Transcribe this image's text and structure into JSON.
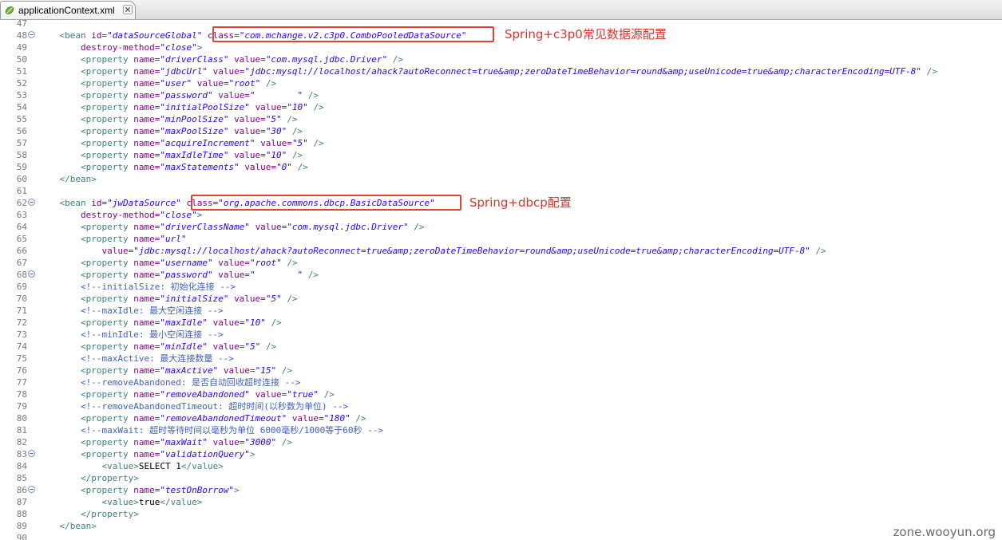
{
  "tab": {
    "label": "applicationContext.xml",
    "icon": "xml-leaf-icon",
    "close_icon": "close-icon"
  },
  "annotations": {
    "c3p0": "Spring+c3p0常见数据源配置",
    "dbcp": "Spring+dbcp配置"
  },
  "watermark": "zone.wooyun.org",
  "colors": {
    "tag": "#3f7f7f",
    "attr": "#7f007f",
    "value": "#2a00ff",
    "comment": "#3f5fbf",
    "highlight": "#e0462f"
  },
  "lines": [
    {
      "n": "47",
      "fold": false,
      "tokens": []
    },
    {
      "n": "48",
      "fold": true,
      "tokens": [
        [
          "p",
          "    "
        ],
        [
          "tag",
          "<bean "
        ],
        [
          "attr",
          "id="
        ],
        [
          "val",
          "\"dataSourceGlobal\""
        ],
        [
          "p",
          " "
        ],
        [
          "attr",
          "class="
        ],
        [
          "val",
          "\"com.mchange.v2.c3p0.ComboPooledDataSource\""
        ]
      ]
    },
    {
      "n": "49",
      "fold": false,
      "tokens": [
        [
          "p",
          "        "
        ],
        [
          "attr",
          "destroy-method="
        ],
        [
          "val",
          "\"close\""
        ],
        [
          "tag",
          ">"
        ]
      ]
    },
    {
      "n": "50",
      "fold": false,
      "tokens": [
        [
          "p",
          "        "
        ],
        [
          "tag",
          "<property "
        ],
        [
          "attr",
          "name="
        ],
        [
          "val",
          "\"driverClass\""
        ],
        [
          "p",
          " "
        ],
        [
          "attr",
          "value="
        ],
        [
          "val",
          "\"com.mysql.jdbc.Driver\""
        ],
        [
          "p",
          " "
        ],
        [
          "tag",
          "/>"
        ]
      ]
    },
    {
      "n": "51",
      "fold": false,
      "tokens": [
        [
          "p",
          "        "
        ],
        [
          "tag",
          "<property "
        ],
        [
          "attr",
          "name="
        ],
        [
          "val",
          "\"jdbcUrl\""
        ],
        [
          "p",
          " "
        ],
        [
          "attr",
          "value="
        ],
        [
          "val",
          "\"jdbc:mysql://localhost/ahack?autoReconnect=true&amp;zeroDateTimeBehavior=round&amp;useUnicode=true&amp;characterEncoding=UTF-8\""
        ],
        [
          "p",
          " "
        ],
        [
          "tag",
          "/>"
        ]
      ]
    },
    {
      "n": "52",
      "fold": false,
      "tokens": [
        [
          "p",
          "        "
        ],
        [
          "tag",
          "<property "
        ],
        [
          "attr",
          "name="
        ],
        [
          "val",
          "\"user\""
        ],
        [
          "p",
          " "
        ],
        [
          "attr",
          "value="
        ],
        [
          "val",
          "\"root\""
        ],
        [
          "p",
          " "
        ],
        [
          "tag",
          "/>"
        ]
      ]
    },
    {
      "n": "53",
      "fold": false,
      "tokens": [
        [
          "p",
          "        "
        ],
        [
          "tag",
          "<property "
        ],
        [
          "attr",
          "name="
        ],
        [
          "val",
          "\"password\""
        ],
        [
          "p",
          " "
        ],
        [
          "attr",
          "value="
        ],
        [
          "val",
          "\"        \""
        ],
        [
          "p",
          " "
        ],
        [
          "tag",
          "/>"
        ]
      ],
      "redact": true
    },
    {
      "n": "54",
      "fold": false,
      "tokens": [
        [
          "p",
          "        "
        ],
        [
          "tag",
          "<property "
        ],
        [
          "attr",
          "name="
        ],
        [
          "val",
          "\"initialPoolSize\""
        ],
        [
          "p",
          " "
        ],
        [
          "attr",
          "value="
        ],
        [
          "val",
          "\"10\""
        ],
        [
          "p",
          " "
        ],
        [
          "tag",
          "/>"
        ]
      ]
    },
    {
      "n": "55",
      "fold": false,
      "tokens": [
        [
          "p",
          "        "
        ],
        [
          "tag",
          "<property "
        ],
        [
          "attr",
          "name="
        ],
        [
          "val",
          "\"minPoolSize\""
        ],
        [
          "p",
          " "
        ],
        [
          "attr",
          "value="
        ],
        [
          "val",
          "\"5\""
        ],
        [
          "p",
          " "
        ],
        [
          "tag",
          "/>"
        ]
      ]
    },
    {
      "n": "56",
      "fold": false,
      "tokens": [
        [
          "p",
          "        "
        ],
        [
          "tag",
          "<property "
        ],
        [
          "attr",
          "name="
        ],
        [
          "val",
          "\"maxPoolSize\""
        ],
        [
          "p",
          " "
        ],
        [
          "attr",
          "value="
        ],
        [
          "val",
          "\"30\""
        ],
        [
          "p",
          " "
        ],
        [
          "tag",
          "/>"
        ]
      ]
    },
    {
      "n": "57",
      "fold": false,
      "tokens": [
        [
          "p",
          "        "
        ],
        [
          "tag",
          "<property "
        ],
        [
          "attr",
          "name="
        ],
        [
          "val",
          "\"acquireIncrement\""
        ],
        [
          "p",
          " "
        ],
        [
          "attr",
          "value="
        ],
        [
          "val",
          "\"5\""
        ],
        [
          "p",
          " "
        ],
        [
          "tag",
          "/>"
        ]
      ]
    },
    {
      "n": "58",
      "fold": false,
      "tokens": [
        [
          "p",
          "        "
        ],
        [
          "tag",
          "<property "
        ],
        [
          "attr",
          "name="
        ],
        [
          "val",
          "\"maxIdleTime\""
        ],
        [
          "p",
          " "
        ],
        [
          "attr",
          "value="
        ],
        [
          "val",
          "\"10\""
        ],
        [
          "p",
          " "
        ],
        [
          "tag",
          "/>"
        ]
      ]
    },
    {
      "n": "59",
      "fold": false,
      "tokens": [
        [
          "p",
          "        "
        ],
        [
          "tag",
          "<property "
        ],
        [
          "attr",
          "name="
        ],
        [
          "val",
          "\"maxStatements\""
        ],
        [
          "p",
          " "
        ],
        [
          "attr",
          "value="
        ],
        [
          "val",
          "\"0\""
        ],
        [
          "p",
          " "
        ],
        [
          "tag",
          "/>"
        ]
      ]
    },
    {
      "n": "60",
      "fold": false,
      "tokens": [
        [
          "p",
          "    "
        ],
        [
          "tag",
          "</bean>"
        ]
      ]
    },
    {
      "n": "61",
      "fold": false,
      "tokens": []
    },
    {
      "n": "62",
      "fold": true,
      "tokens": [
        [
          "p",
          "    "
        ],
        [
          "tag",
          "<bean "
        ],
        [
          "attr",
          "id="
        ],
        [
          "val",
          "\"jwDataSource\""
        ],
        [
          "p",
          " "
        ],
        [
          "attr",
          "class="
        ],
        [
          "val",
          "\"org.apache.commons.dbcp.BasicDataSource\""
        ]
      ]
    },
    {
      "n": "63",
      "fold": false,
      "tokens": [
        [
          "p",
          "        "
        ],
        [
          "attr",
          "destroy-method="
        ],
        [
          "val",
          "\"close\""
        ],
        [
          "tag",
          ">"
        ]
      ]
    },
    {
      "n": "64",
      "fold": false,
      "tokens": [
        [
          "p",
          "        "
        ],
        [
          "tag",
          "<property "
        ],
        [
          "attr",
          "name="
        ],
        [
          "val",
          "\"driverClassName\""
        ],
        [
          "p",
          " "
        ],
        [
          "attr",
          "value="
        ],
        [
          "val",
          "\"com.mysql.jdbc.Driver\""
        ],
        [
          "p",
          " "
        ],
        [
          "tag",
          "/>"
        ]
      ]
    },
    {
      "n": "65",
      "fold": false,
      "tokens": [
        [
          "p",
          "        "
        ],
        [
          "tag",
          "<property "
        ],
        [
          "attr",
          "name="
        ],
        [
          "val",
          "\"url\""
        ]
      ]
    },
    {
      "n": "66",
      "fold": false,
      "tokens": [
        [
          "p",
          "            "
        ],
        [
          "attr",
          "value="
        ],
        [
          "val",
          "\"jdbc:mysql://localhost/ahack?autoReconnect=true&amp;zeroDateTimeBehavior=round&amp;useUnicode=true&amp;characterEncoding=UTF-8\""
        ],
        [
          "p",
          " "
        ],
        [
          "tag",
          "/>"
        ]
      ]
    },
    {
      "n": "67",
      "fold": false,
      "tokens": [
        [
          "p",
          "        "
        ],
        [
          "tag",
          "<property "
        ],
        [
          "attr",
          "name="
        ],
        [
          "val",
          "\"username\""
        ],
        [
          "p",
          " "
        ],
        [
          "attr",
          "value="
        ],
        [
          "val",
          "\"root\""
        ],
        [
          "p",
          " "
        ],
        [
          "tag",
          "/>"
        ]
      ]
    },
    {
      "n": "68",
      "fold": true,
      "tokens": [
        [
          "p",
          "        "
        ],
        [
          "tag",
          "<property "
        ],
        [
          "attr",
          "name="
        ],
        [
          "val",
          "\"password\""
        ],
        [
          "p",
          " "
        ],
        [
          "attr",
          "value="
        ],
        [
          "val",
          "\"        \""
        ],
        [
          "p",
          " "
        ],
        [
          "tag",
          "/>"
        ]
      ],
      "redact": true
    },
    {
      "n": "69",
      "fold": false,
      "tokens": [
        [
          "p",
          "        "
        ],
        [
          "com",
          "<!--initialSize: 初始化连接 -->"
        ]
      ]
    },
    {
      "n": "70",
      "fold": false,
      "tokens": [
        [
          "p",
          "        "
        ],
        [
          "tag",
          "<property "
        ],
        [
          "attr",
          "name="
        ],
        [
          "val",
          "\"initialSize\""
        ],
        [
          "p",
          " "
        ],
        [
          "attr",
          "value="
        ],
        [
          "val",
          "\"5\""
        ],
        [
          "p",
          " "
        ],
        [
          "tag",
          "/>"
        ]
      ]
    },
    {
      "n": "71",
      "fold": false,
      "tokens": [
        [
          "p",
          "        "
        ],
        [
          "com",
          "<!--maxIdle: 最大空闲连接 -->"
        ]
      ]
    },
    {
      "n": "72",
      "fold": false,
      "tokens": [
        [
          "p",
          "        "
        ],
        [
          "tag",
          "<property "
        ],
        [
          "attr",
          "name="
        ],
        [
          "val",
          "\"maxIdle\""
        ],
        [
          "p",
          " "
        ],
        [
          "attr",
          "value="
        ],
        [
          "val",
          "\"10\""
        ],
        [
          "p",
          " "
        ],
        [
          "tag",
          "/>"
        ]
      ]
    },
    {
      "n": "73",
      "fold": false,
      "tokens": [
        [
          "p",
          "        "
        ],
        [
          "com",
          "<!--minIdle: 最小空闲连接 -->"
        ]
      ]
    },
    {
      "n": "74",
      "fold": false,
      "tokens": [
        [
          "p",
          "        "
        ],
        [
          "tag",
          "<property "
        ],
        [
          "attr",
          "name="
        ],
        [
          "val",
          "\"minIdle\""
        ],
        [
          "p",
          " "
        ],
        [
          "attr",
          "value="
        ],
        [
          "val",
          "\"5\""
        ],
        [
          "p",
          " "
        ],
        [
          "tag",
          "/>"
        ]
      ]
    },
    {
      "n": "75",
      "fold": false,
      "tokens": [
        [
          "p",
          "        "
        ],
        [
          "com",
          "<!--maxActive: 最大连接数量 -->"
        ]
      ]
    },
    {
      "n": "76",
      "fold": false,
      "tokens": [
        [
          "p",
          "        "
        ],
        [
          "tag",
          "<property "
        ],
        [
          "attr",
          "name="
        ],
        [
          "val",
          "\"maxActive\""
        ],
        [
          "p",
          " "
        ],
        [
          "attr",
          "value="
        ],
        [
          "val",
          "\"15\""
        ],
        [
          "p",
          " "
        ],
        [
          "tag",
          "/>"
        ]
      ]
    },
    {
      "n": "77",
      "fold": false,
      "tokens": [
        [
          "p",
          "        "
        ],
        [
          "com",
          "<!--removeAbandoned: 是否自动回收超时连接 -->"
        ]
      ]
    },
    {
      "n": "78",
      "fold": false,
      "tokens": [
        [
          "p",
          "        "
        ],
        [
          "tag",
          "<property "
        ],
        [
          "attr",
          "name="
        ],
        [
          "val",
          "\"removeAbandoned\""
        ],
        [
          "p",
          " "
        ],
        [
          "attr",
          "value="
        ],
        [
          "val",
          "\"true\""
        ],
        [
          "p",
          " "
        ],
        [
          "tag",
          "/>"
        ]
      ]
    },
    {
      "n": "79",
      "fold": false,
      "tokens": [
        [
          "p",
          "        "
        ],
        [
          "com",
          "<!--removeAbandonedTimeout: 超时时间(以秒数为单位) -->"
        ]
      ]
    },
    {
      "n": "80",
      "fold": false,
      "tokens": [
        [
          "p",
          "        "
        ],
        [
          "tag",
          "<property "
        ],
        [
          "attr",
          "name="
        ],
        [
          "val",
          "\"removeAbandonedTimeout\""
        ],
        [
          "p",
          " "
        ],
        [
          "attr",
          "value="
        ],
        [
          "val",
          "\"180\""
        ],
        [
          "p",
          " "
        ],
        [
          "tag",
          "/>"
        ]
      ]
    },
    {
      "n": "81",
      "fold": false,
      "tokens": [
        [
          "p",
          "        "
        ],
        [
          "com",
          "<!--maxWait: 超时等待时间以毫秒为单位 6000毫秒/1000等于60秒 -->"
        ]
      ]
    },
    {
      "n": "82",
      "fold": false,
      "tokens": [
        [
          "p",
          "        "
        ],
        [
          "tag",
          "<property "
        ],
        [
          "attr",
          "name="
        ],
        [
          "val",
          "\"maxWait\""
        ],
        [
          "p",
          " "
        ],
        [
          "attr",
          "value="
        ],
        [
          "val",
          "\"3000\""
        ],
        [
          "p",
          " "
        ],
        [
          "tag",
          "/>"
        ]
      ]
    },
    {
      "n": "83",
      "fold": true,
      "tokens": [
        [
          "p",
          "        "
        ],
        [
          "tag",
          "<property "
        ],
        [
          "attr",
          "name="
        ],
        [
          "val",
          "\"validationQuery\""
        ],
        [
          "tag",
          ">"
        ]
      ]
    },
    {
      "n": "84",
      "fold": false,
      "tokens": [
        [
          "p",
          "            "
        ],
        [
          "tag",
          "<value>"
        ],
        [
          "txt",
          "SELECT 1"
        ],
        [
          "tag",
          "</value>"
        ]
      ]
    },
    {
      "n": "85",
      "fold": false,
      "tokens": [
        [
          "p",
          "        "
        ],
        [
          "tag",
          "</property>"
        ]
      ]
    },
    {
      "n": "86",
      "fold": true,
      "tokens": [
        [
          "p",
          "        "
        ],
        [
          "tag",
          "<property "
        ],
        [
          "attr",
          "name="
        ],
        [
          "val",
          "\"testOnBorrow\""
        ],
        [
          "tag",
          ">"
        ]
      ]
    },
    {
      "n": "87",
      "fold": false,
      "tokens": [
        [
          "p",
          "            "
        ],
        [
          "tag",
          "<value>"
        ],
        [
          "txt",
          "true"
        ],
        [
          "tag",
          "</value>"
        ]
      ]
    },
    {
      "n": "88",
      "fold": false,
      "tokens": [
        [
          "p",
          "        "
        ],
        [
          "tag",
          "</property>"
        ]
      ]
    },
    {
      "n": "89",
      "fold": false,
      "tokens": [
        [
          "p",
          "    "
        ],
        [
          "tag",
          "</bean>"
        ]
      ]
    },
    {
      "n": "90",
      "fold": false,
      "tokens": []
    }
  ]
}
